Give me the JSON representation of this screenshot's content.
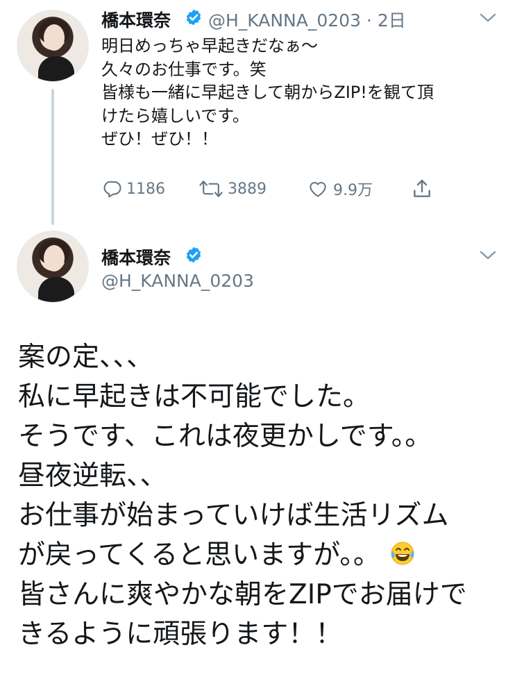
{
  "tweet1": {
    "author_name": "橋本環奈",
    "handle_time": "@H_KANNA_0203 · 2日",
    "lines": [
      "明日めっちゃ早起きだなぁ〜",
      "久々のお仕事です。笑",
      "皆様も一緒に早起きして朝からZIP!を観て頂",
      "けたら嬉しいです。",
      "ぜひ！ぜひ！！"
    ],
    "reply_count": "1186",
    "retweet_count": "3889",
    "like_count": "9.9万"
  },
  "tweet2": {
    "author_name": "橋本環奈",
    "handle": "@H_KANNA_0203",
    "lines": [
      "案の定、、、",
      "私に早起きは不可能でした。",
      "そうです、これは夜更かしです。。",
      "昼夜逆転、、",
      "お仕事が始まっていけば生活リズム",
      "が戻ってくると思いますが。。",
      "皆さんに爽やかな朝をZIPでお届けで",
      "きるように頑張ります！！"
    ]
  },
  "colors": {
    "text": "#14171a",
    "secondary": "#657786",
    "verified": "#1da1f2",
    "thread_line": "#ccd6dd"
  },
  "icons": [
    "verified-badge-icon",
    "chevron-down-icon",
    "reply-icon",
    "retweet-icon",
    "like-icon",
    "share-icon",
    "tears-of-joy-emoji"
  ]
}
